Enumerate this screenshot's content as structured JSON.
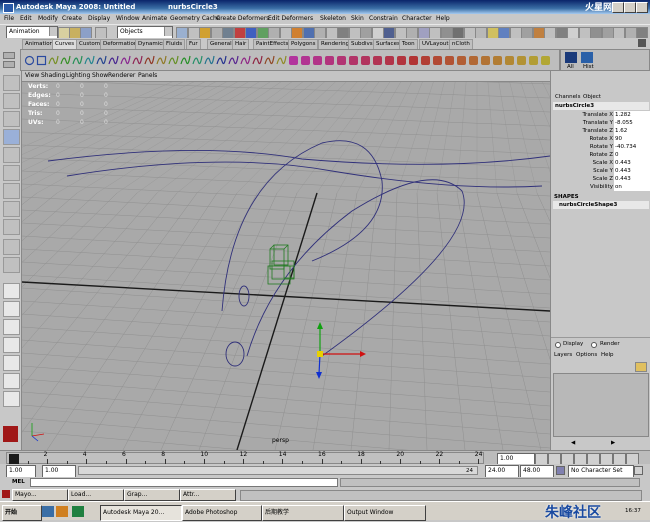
{
  "window": {
    "title": "Autodesk Maya 2008: Untitled",
    "document": "nurbsCircle3",
    "watermark_top": "火星网",
    "watermark_bottom": "朱峰社区"
  },
  "menubar": [
    "File",
    "Edit",
    "Modify",
    "Create",
    "Display",
    "Window",
    "Animate",
    "Geometry Cache",
    "Create Deformers",
    "Edit Deformers",
    "Skeleton",
    "Skin",
    "Constrain",
    "Character",
    "Help"
  ],
  "status_line": {
    "mode": "Animation",
    "selection_mask": "Objects"
  },
  "shelf_tabs": [
    {
      "label": "Animation",
      "active": false
    },
    {
      "label": "Curves",
      "active": true
    },
    {
      "label": "Custom",
      "active": false
    },
    {
      "label": "Deformation",
      "active": false
    },
    {
      "label": "Dynamics",
      "active": false
    },
    {
      "label": "Fluids",
      "active": false
    },
    {
      "label": "Fur",
      "active": false
    },
    {
      "label": "General",
      "active": false
    },
    {
      "label": "Hair",
      "active": false
    },
    {
      "label": "PaintEffects",
      "active": false
    },
    {
      "label": "Polygons",
      "active": false
    },
    {
      "label": "Rendering",
      "active": false
    },
    {
      "label": "Subdivs",
      "active": false
    },
    {
      "label": "Surfaces",
      "active": false
    },
    {
      "label": "Toon",
      "active": false
    },
    {
      "label": "UVLayout",
      "active": false
    },
    {
      "label": "nCloth",
      "active": false
    }
  ],
  "shelf_right_labels": [
    "All",
    "Hist"
  ],
  "viewport": {
    "menu": [
      "View",
      "Shading",
      "Lighting",
      "Show",
      "Renderer",
      "Panels"
    ],
    "hud": [
      {
        "label": "Verts:",
        "v1": "0",
        "v2": "0",
        "v3": "0"
      },
      {
        "label": "Edges:",
        "v1": "0",
        "v2": "0",
        "v3": "0"
      },
      {
        "label": "Faces:",
        "v1": "0",
        "v2": "0",
        "v3": "0"
      },
      {
        "label": "Tris:",
        "v1": "0",
        "v2": "0",
        "v3": "0"
      },
      {
        "label": "UVs:",
        "v1": "0",
        "v2": "0",
        "v3": "0"
      }
    ],
    "camera_label": "persp"
  },
  "channel_box": {
    "tabs": [
      "Channels",
      "Object"
    ],
    "object": "nurbsCircle3",
    "attributes": [
      {
        "name": "Translate X",
        "value": "1.282"
      },
      {
        "name": "Translate Y",
        "value": "-8.055"
      },
      {
        "name": "Translate Z",
        "value": "1.62"
      },
      {
        "name": "Rotate X",
        "value": "90"
      },
      {
        "name": "Rotate Y",
        "value": "-40.734"
      },
      {
        "name": "Rotate Z",
        "value": "0"
      },
      {
        "name": "Scale X",
        "value": "0.443"
      },
      {
        "name": "Scale Y",
        "value": "0.443"
      },
      {
        "name": "Scale Z",
        "value": "0.443"
      },
      {
        "name": "Visibility",
        "value": "on"
      }
    ],
    "shapes_header": "SHAPES",
    "shape": "nurbsCircleShape3",
    "layer_radio": [
      "Display",
      "Render"
    ],
    "layer_menu": [
      "Layers",
      "Options",
      "Help"
    ]
  },
  "time_slider": {
    "ticks": [
      "2",
      "4",
      "6",
      "8",
      "10",
      "12",
      "14",
      "16",
      "18",
      "20",
      "22",
      "24"
    ],
    "current_frame": "1.00"
  },
  "range_slider": {
    "start": "1.00",
    "playback_start": "1.00",
    "playback_end_marker": "24",
    "playback_end": "24.00",
    "end": "48.00",
    "character_set": "No Character Set"
  },
  "command_line": {
    "label": "MEL"
  },
  "help_line": {
    "items": [
      "Mayo...",
      "Load...",
      "Grap...",
      "Attr..."
    ]
  },
  "taskbar": {
    "start": "开始",
    "buttons": [
      "Autodesk Maya 20...",
      "Adobe Photoshop",
      "后期教学",
      "Output Window"
    ],
    "clock": "16:37"
  }
}
